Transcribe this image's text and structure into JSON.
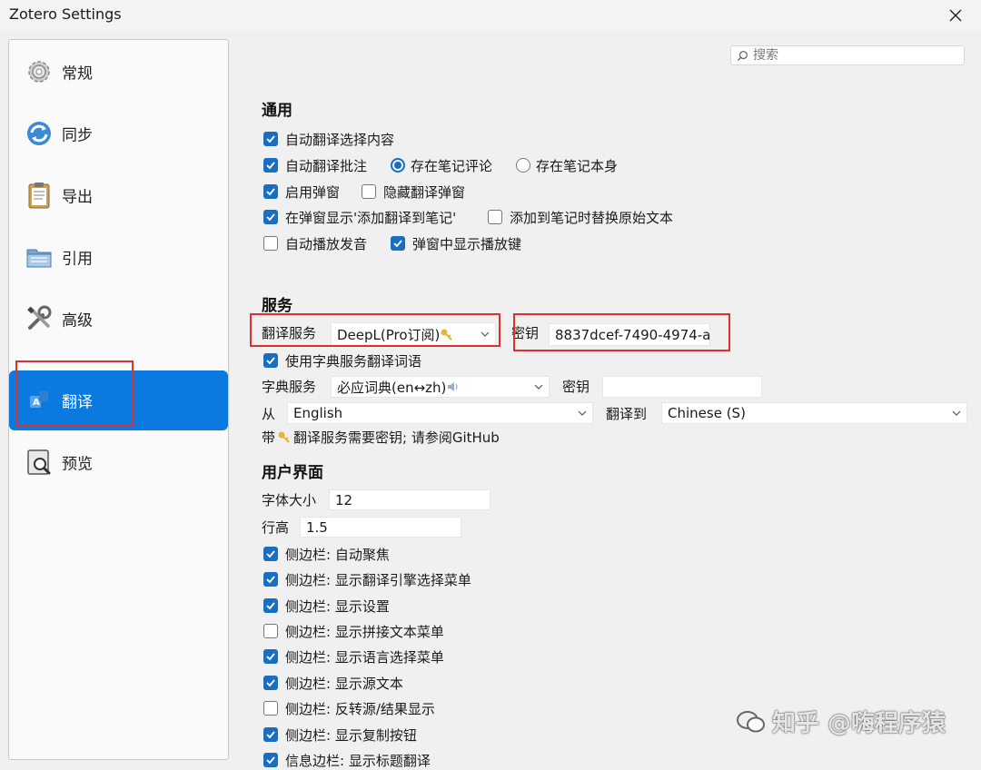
{
  "window": {
    "title": "Zotero Settings"
  },
  "search": {
    "placeholder": "搜索"
  },
  "sidebar": {
    "items": [
      {
        "label": "常规",
        "icon": "gear-icon"
      },
      {
        "label": "同步",
        "icon": "sync-icon"
      },
      {
        "label": "导出",
        "icon": "clipboard-icon"
      },
      {
        "label": "引用",
        "icon": "folder-icon"
      },
      {
        "label": "高级",
        "icon": "tools-icon"
      },
      {
        "label": "翻译",
        "icon": "translate-icon",
        "selected": true
      },
      {
        "label": "预览",
        "icon": "preview-icon"
      }
    ]
  },
  "general": {
    "heading": "通用",
    "auto_translate_selection": "自动翻译选择内容",
    "auto_translate_annotation": "自动翻译批注",
    "save_note_comment": "存在笔记评论",
    "save_note_body": "存在笔记本身",
    "enable_popup": "启用弹窗",
    "hide_popup_translation": "隐藏翻译弹窗",
    "show_add_to_note": "在弹窗显示'添加翻译到笔记'",
    "replace_original_text": "添加到笔记时替换原始文本",
    "autoplay_audio": "自动播放发音",
    "show_play_key": "弹窗中显示播放键"
  },
  "service": {
    "heading": "服务",
    "translate_service_label": "翻译服务",
    "translate_service_value": "DeepL(Pro订阅)",
    "key_label": "密钥",
    "key_value": "8837dcef-7490-4974-a",
    "use_dict": "使用字典服务翻译词语",
    "dict_label": "字典服务",
    "dict_value": "必应词典(en↔zh)",
    "dict_key_label": "密钥",
    "dict_key_value": "",
    "from_label": "从",
    "from_value": "English",
    "to_label": "翻译到",
    "to_value": "Chinese (S)",
    "note_prefix": "带",
    "note_suffix": "翻译服务需要密钥; 请参阅GitHub"
  },
  "ui": {
    "heading": "用户界面",
    "font_size_label": "字体大小",
    "font_size_value": "12",
    "line_height_label": "行高",
    "line_height_value": "1.5",
    "options": [
      {
        "label": "侧边栏: 自动聚焦",
        "checked": true
      },
      {
        "label": "侧边栏: 显示翻译引擎选择菜单",
        "checked": true
      },
      {
        "label": "侧边栏: 显示设置",
        "checked": true
      },
      {
        "label": "侧边栏: 显示拼接文本菜单",
        "checked": false
      },
      {
        "label": "侧边栏: 显示语言选择菜单",
        "checked": true
      },
      {
        "label": "侧边栏: 显示源文本",
        "checked": true
      },
      {
        "label": "侧边栏: 反转源/结果显示",
        "checked": false
      },
      {
        "label": "侧边栏: 显示复制按钮",
        "checked": true
      },
      {
        "label": "信息边栏: 显示标题翻译",
        "checked": true
      }
    ]
  },
  "watermark": {
    "text": "知乎 @嗨程序猿"
  },
  "colors": {
    "accent": "#0a7ae0",
    "checkbox": "#1a6ec2",
    "highlight_box": "#e0302e"
  }
}
